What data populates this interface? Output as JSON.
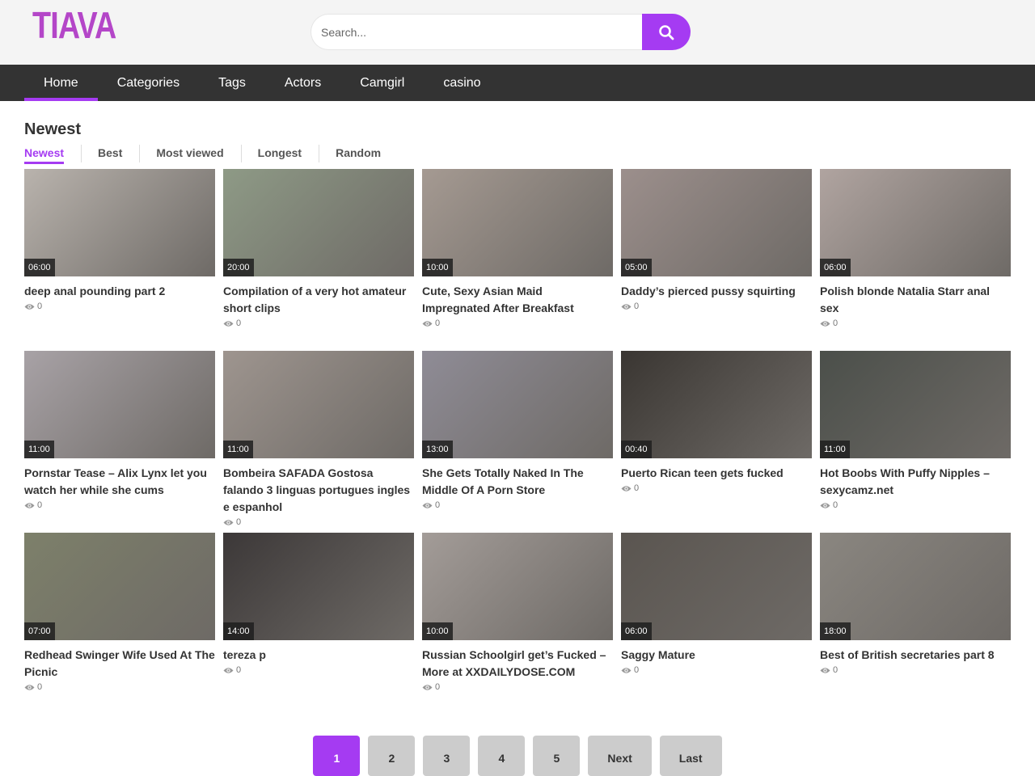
{
  "site": {
    "logo": "TIAVA",
    "accent_color": "#a53bf2"
  },
  "search": {
    "placeholder": "Search...",
    "value": "",
    "button_icon": "search-icon"
  },
  "nav": {
    "items": [
      {
        "label": "Home",
        "active": true
      },
      {
        "label": "Categories"
      },
      {
        "label": "Tags"
      },
      {
        "label": "Actors"
      },
      {
        "label": "Camgirl"
      },
      {
        "label": "casino"
      }
    ]
  },
  "main": {
    "title": "Newest",
    "filters": [
      {
        "label": "Newest",
        "active": true
      },
      {
        "label": "Best"
      },
      {
        "label": "Most viewed"
      },
      {
        "label": "Longest"
      },
      {
        "label": "Random"
      }
    ],
    "videos": [
      {
        "title": "deep anal pounding part 2",
        "duration": "06:00",
        "views": "0"
      },
      {
        "title": "Compilation of a very hot amateur short clips",
        "duration": "20:00",
        "views": "0"
      },
      {
        "title": "Cute, Sexy Asian Maid Impregnated After Breakfast",
        "duration": "10:00",
        "views": "0"
      },
      {
        "title": "Daddy’s pierced pussy squirting",
        "duration": "05:00",
        "views": "0"
      },
      {
        "title": "Polish blonde Natalia Starr anal sex",
        "duration": "06:00",
        "views": "0"
      },
      {
        "title": "Pornstar Tease – Alix Lynx let you watch her while she cums",
        "duration": "11:00",
        "views": "0"
      },
      {
        "title": "Bombeira SAFADA Gostosa falando 3 linguas portugues ingles e espanhol",
        "duration": "11:00",
        "views": "0"
      },
      {
        "title": "She Gets Totally Naked In The Middle Of A Porn Store",
        "duration": "13:00",
        "views": "0"
      },
      {
        "title": "Puerto Rican teen gets fucked",
        "duration": "00:40",
        "views": "0"
      },
      {
        "title": "Hot Boobs With Puffy Nipples – sexycamz.net",
        "duration": "11:00",
        "views": "0"
      },
      {
        "title": "Redhead Swinger Wife Used At The Picnic",
        "duration": "07:00",
        "views": "0"
      },
      {
        "title": "tereza p",
        "duration": "14:00",
        "views": "0"
      },
      {
        "title": "Russian Schoolgirl get’s Fucked – More at XXDAILYDOSE.COM",
        "duration": "10:00",
        "views": "0"
      },
      {
        "title": "Saggy Mature",
        "duration": "06:00",
        "views": "0"
      },
      {
        "title": "Best of British secretaries part 8",
        "duration": "18:00",
        "views": "0"
      }
    ]
  },
  "pagination": {
    "pages": [
      "1",
      "2",
      "3",
      "4",
      "5"
    ],
    "current": "1",
    "next_label": "Next",
    "last_label": "Last"
  }
}
